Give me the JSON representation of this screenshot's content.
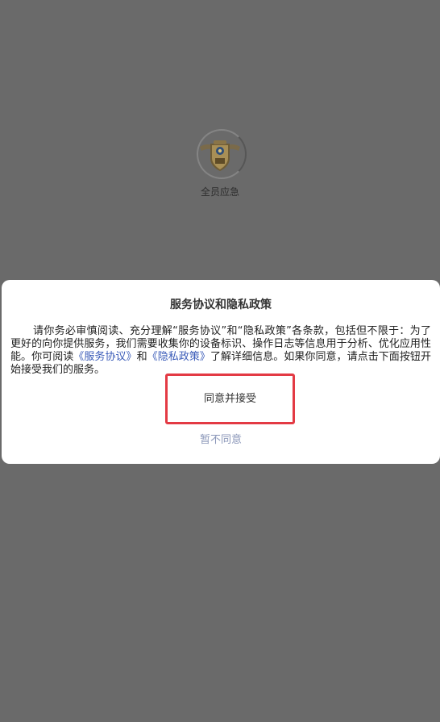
{
  "splash": {
    "app_name": "全员应急",
    "logo_icon": "police-badge-icon"
  },
  "dialog": {
    "title": "服务协议和隐私政策",
    "body": {
      "part1": "请你务必审慎阅读、充分理解“服务协议”和“隐私政策”各条款，包括但不限于：为了更好的向你提供服务，我们需要收集你的设备标识、操作日志等信息用于分析、优化应用性能。你可阅读",
      "link_service": "《服务协议》",
      "and": "和",
      "link_privacy": "《隐私政策》",
      "part2": "了解详细信息。如果你同意，请点击下面按钮开始接受我们的服务。"
    },
    "agree_label": "同意并接受",
    "decline_label": "暂不同意"
  },
  "colors": {
    "overlay": "#6a6a6a",
    "link": "#3a5bb8",
    "decline": "#8a96b8",
    "highlight": "#e33a44"
  }
}
